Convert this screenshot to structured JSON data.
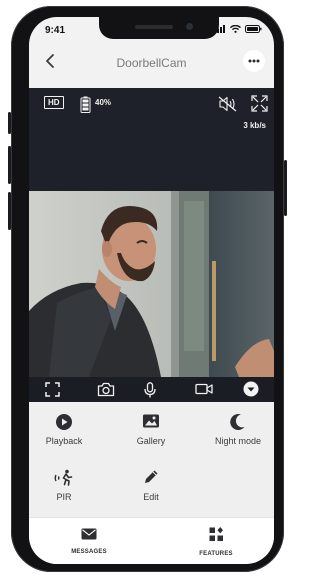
{
  "status_bar": {
    "time": "9:41"
  },
  "header": {
    "title": "DoorbellCam"
  },
  "live": {
    "quality_badge": "HD",
    "battery_percent": "40%",
    "bitrate": "3 kb/s",
    "battery_level": 0.4
  },
  "controls": [
    "fullscreen-icon",
    "camera-icon",
    "microphone-icon",
    "video-record-icon",
    "chevron-down-icon"
  ],
  "features": [
    {
      "label": "Playback",
      "icon": "play-icon"
    },
    {
      "label": "Gallery",
      "icon": "image-icon"
    },
    {
      "label": "Night mode",
      "icon": "moon-icon"
    },
    {
      "label": "PIR",
      "icon": "motion-icon"
    },
    {
      "label": "Edit",
      "icon": "pencil-icon"
    }
  ],
  "tabs": [
    {
      "label": "MESSAGES",
      "icon": "envelope-icon"
    },
    {
      "label": "FEATURES",
      "icon": "features-grid-icon"
    }
  ]
}
